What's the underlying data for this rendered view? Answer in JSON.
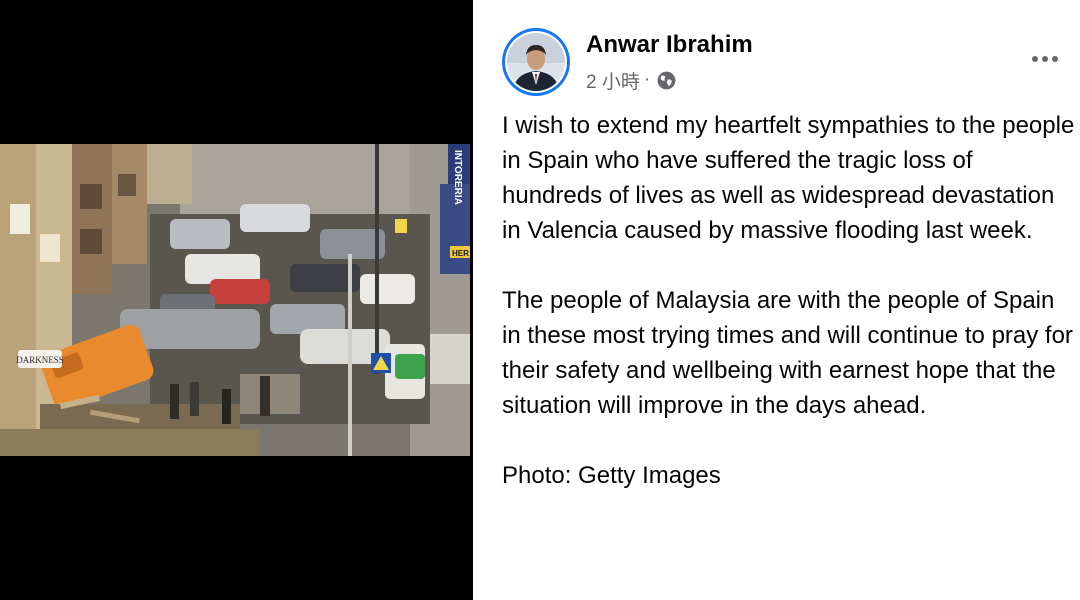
{
  "post": {
    "author": "Anwar Ibrahim",
    "time": "2 小時",
    "separator": "·",
    "audience_icon": "globe-icon",
    "more_icon": "ellipsis-icon",
    "paragraphs": [
      "I wish to extend my heartfelt sympathies to the people in Spain who have suffered the tragic loss of hundreds of lives as well as widespread devastation in Valencia caused by massive flooding last week.",
      "The people of Malaysia are with the people of Spain in these most trying times and will continue to pray for their safety and wellbeing with earnest hope that the situation will improve in the days ahead.",
      "Photo: Getty Images"
    ]
  },
  "photo": {
    "shop_sign": "DARKNESS",
    "vertical_sign": "INTORERIA",
    "corner_sign": "HER"
  },
  "colors": {
    "accent": "#1877f2",
    "text_primary": "#050505",
    "text_secondary": "#65676b",
    "media_background": "#000000"
  }
}
